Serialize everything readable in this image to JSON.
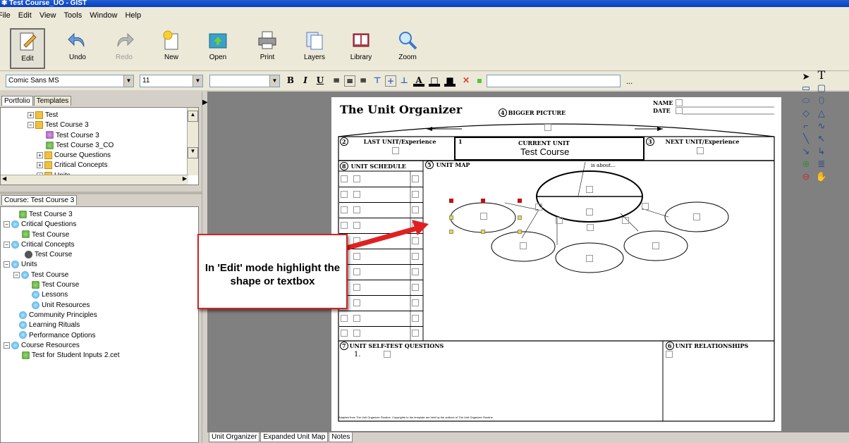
{
  "window": {
    "title": "Test Course_UO - GIST"
  },
  "menu": [
    "File",
    "Edit",
    "View",
    "Tools",
    "Window",
    "Help"
  ],
  "toolbar": {
    "edit": "Edit",
    "undo": "Undo",
    "redo": "Redo",
    "new": "New",
    "open": "Open",
    "print": "Print",
    "layers": "Layers",
    "library": "Library",
    "zoom": "Zoom"
  },
  "format": {
    "font": "Comic Sans MS",
    "size": "11",
    "style": "",
    "ellipsis": "..."
  },
  "portfolio": {
    "tabs": [
      "Portfolio",
      "Templates"
    ],
    "nodes": [
      "Test",
      "Test Course 3",
      "Test Course 3",
      "Test Course 3_CO",
      "Course Questions",
      "Critical Concepts",
      "Units"
    ]
  },
  "course": {
    "tab": "Course: Test Course 3",
    "nodes": [
      "Test Course 3",
      "Critical Questions",
      "Test Course",
      "Critical Concepts",
      "Test Course",
      "Units",
      "Test Course",
      "Test Course",
      "Lessons",
      "Unit Resources",
      "Community Principles",
      "Learning Rituals",
      "Performance Options",
      "Course Resources",
      "Test for Student Inputs 2.cet"
    ]
  },
  "doc": {
    "title": "The Unit Organizer",
    "name": "NAME",
    "date": "DATE",
    "bigger": "BIGGER PICTURE",
    "last": "LAST UNIT/Experience",
    "current": "CURRENT UNIT",
    "current_value": "Test Course",
    "next": "NEXT UNIT/Experience",
    "schedule": "UNIT SCHEDULE",
    "map": "UNIT MAP",
    "is_about": "is about...",
    "selftest": "UNIT SELF-TEST QUESTIONS",
    "selftest_item": "1.",
    "relationships": "UNIT RELATIONSHIPS",
    "footer": "Adapted from The Unit Organizer Routine. Copyrights to the template are held by the authors of The Unit Organizer Routine.",
    "num": {
      "bigger": "4",
      "last": "2",
      "current": "1",
      "next": "3",
      "schedule": "8",
      "map": "5",
      "selftest": "7",
      "relationships": "6"
    }
  },
  "callout": {
    "text": "In 'Edit' mode highlight the shape or textbox"
  },
  "bottom_tabs": [
    "Unit Organizer",
    "Expanded Unit Map",
    "Notes"
  ],
  "icons": {
    "select": "pointer-icon",
    "text": "text-tool-icon"
  }
}
